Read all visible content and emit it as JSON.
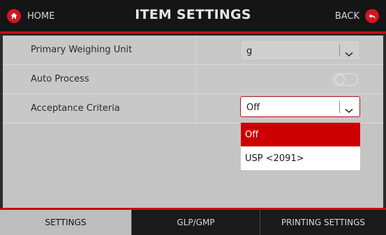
{
  "header": {
    "home_label": "HOME",
    "title": "ITEM SETTINGS",
    "back_label": "BACK",
    "accent_color": "#d21522"
  },
  "settings": {
    "rows": [
      {
        "label": "Primary Weighing Unit",
        "value": "g",
        "control": "select"
      },
      {
        "label": "Auto Process",
        "control": "toggle",
        "state": "off"
      },
      {
        "label": "Acceptance Criteria",
        "value": "Off",
        "control": "select",
        "open": true
      }
    ]
  },
  "dropdown": {
    "options": [
      "Off",
      "USP <2091>"
    ],
    "selected": "Off"
  },
  "tabs": [
    {
      "label": "SETTINGS",
      "active": true
    },
    {
      "label": "GLP/GMP",
      "active": false
    },
    {
      "label": "PRINTING SETTINGS",
      "active": false
    }
  ]
}
